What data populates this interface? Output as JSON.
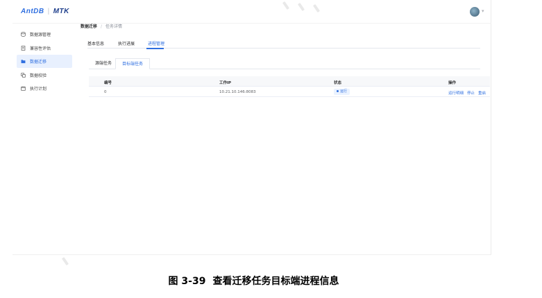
{
  "topbar": {
    "logo_left": "AntDB",
    "logo_sep": "|",
    "logo_right": "MTK"
  },
  "sidebar": {
    "items": [
      {
        "label": "数据源管理",
        "icon": "database-icon",
        "active": false
      },
      {
        "label": "兼容性评估",
        "icon": "document-icon",
        "active": false
      },
      {
        "label": "数据迁移",
        "icon": "folder-icon",
        "active": true
      },
      {
        "label": "数据校验",
        "icon": "copy-icon",
        "active": false
      },
      {
        "label": "执行计划",
        "icon": "calendar-icon",
        "active": false
      }
    ]
  },
  "breadcrumb": {
    "first": "数据迁移",
    "sep": "/",
    "current": "任务详情"
  },
  "tabs": [
    "基本信息",
    "执行进展",
    "进程管理"
  ],
  "active_tab": "进程管理",
  "subtabs": [
    "源端任务",
    "目标端任务"
  ],
  "active_subtab": "目标端任务",
  "table": {
    "headers": [
      "编号",
      "工作IP",
      "状态",
      "操作"
    ],
    "rows": [
      {
        "id": "0",
        "ip": "10.21.10.146:8083",
        "status": "运行",
        "actions": [
          "运行明细",
          "停止",
          "重启"
        ]
      }
    ]
  },
  "caption": {
    "number": "图 3-39",
    "text": "查看迁移任务目标端进程信息"
  },
  "colors": {
    "accent": "#2f6fe0",
    "active_bg": "#e8f0fe",
    "status_bg": "#eaf2ff"
  }
}
